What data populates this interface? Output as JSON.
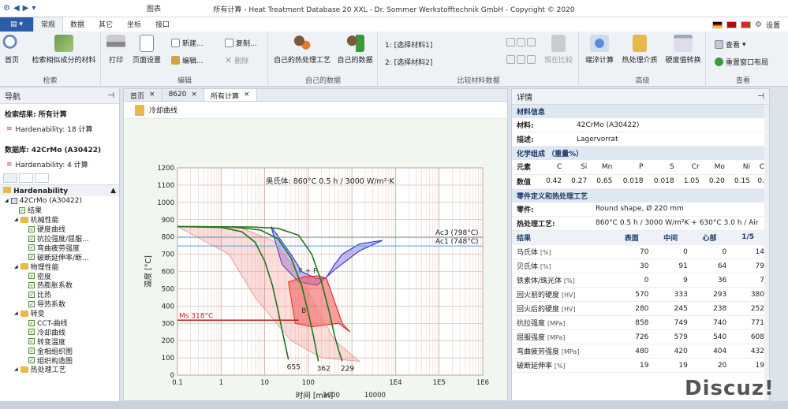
{
  "window": {
    "title": "所有计算 - Heat Treatment Database 20 XXL - Dr. Sommer Werkstofftechnik GmbH - Copyright © 2020",
    "contextual_group": "图表"
  },
  "ribbon_tabs": [
    "常规",
    "数据",
    "其它",
    "坐标",
    "接口"
  ],
  "settings_label": "设置",
  "ribbon": {
    "search": {
      "home": "首页",
      "similar": "检索相似成分的材料",
      "group": "检索"
    },
    "edit": {
      "print": "打印",
      "page_setup": "页面设置",
      "new": "新建...",
      "edit": "编辑...",
      "copy": "复制...",
      "delete": "删除",
      "group": "编辑"
    },
    "own": {
      "own_ht": "自己的热处理工艺",
      "own_data": "自己的数据",
      "group": "自己的数据"
    },
    "compare": {
      "sel1": "1: [选择材料1]",
      "sel2": "2: [选择材料2]",
      "compare_now": "现在比较",
      "group": "比较材料数据"
    },
    "advanced": {
      "quench_calc": "端淬计算",
      "ht_media": "热处理介质",
      "hardness_conv": "硬度值转换",
      "group": "高级"
    },
    "view": {
      "view": "查看",
      "reset_layout": "重置窗口布局",
      "group": "查看"
    }
  },
  "nav": {
    "title": "导航",
    "search_result_title": "检索结果: 所有计算",
    "search_result_item": "Hardenability: 18 计算",
    "db_title": "数据库: 42CrMo (A30422)",
    "db_item": "Hardenability: 4 计算",
    "tree_header": "Hardenability",
    "tree": [
      {
        "label": "42CrMo (A30422)",
        "level": 1,
        "type": "grid"
      },
      {
        "label": "结果",
        "level": 2,
        "type": "cb"
      },
      {
        "label": "机械性能",
        "level": 2,
        "type": "folder"
      },
      {
        "label": "硬度曲线",
        "level": 3,
        "type": "cb"
      },
      {
        "label": "抗拉强度/屈服...",
        "level": 3,
        "type": "cb"
      },
      {
        "label": "弯曲疲劳强度",
        "level": 3,
        "type": "cb"
      },
      {
        "label": "破断延伸率/断...",
        "level": 3,
        "type": "cb"
      },
      {
        "label": "物理性能",
        "level": 2,
        "type": "folder"
      },
      {
        "label": "密度",
        "level": 3,
        "type": "cb"
      },
      {
        "label": "热膨胀系数",
        "level": 3,
        "type": "cb"
      },
      {
        "label": "比热",
        "level": 3,
        "type": "cb"
      },
      {
        "label": "导热系数",
        "level": 3,
        "type": "cb"
      },
      {
        "label": "转变",
        "level": 2,
        "type": "folder"
      },
      {
        "label": "CCT-曲线",
        "level": 3,
        "type": "cb"
      },
      {
        "label": "冷却曲线",
        "level": 3,
        "type": "cb"
      },
      {
        "label": "转变温度",
        "level": 3,
        "type": "cb"
      },
      {
        "label": "金相组织图",
        "level": 3,
        "type": "cb"
      },
      {
        "label": "组织构造图",
        "level": 3,
        "type": "cb"
      },
      {
        "label": "热处理工艺",
        "level": 2,
        "type": "folder"
      }
    ]
  },
  "doc_tabs": [
    "首页",
    "8620",
    "所有计算"
  ],
  "doc_title": "冷却曲线",
  "chart_data": {
    "type": "line",
    "title": "奥氏体: 860°C 0.5 h / 3000 W/m²·K",
    "xlabel": "时间 [min]",
    "ylabel": "温度 [°C]",
    "x_scale": "log",
    "xlim": [
      0.1,
      1000000
    ],
    "ylim": [
      0,
      1200
    ],
    "x_ticks": [
      0.1,
      1,
      10,
      100,
      1000,
      10000,
      100000,
      1000000
    ],
    "x_tick_labels": [
      "0.1",
      "1",
      "10",
      "100",
      "1E4",
      "1E5",
      "1E6"
    ],
    "x_tick_values": [
      0.1,
      1,
      10,
      100,
      10000,
      100000,
      1000000
    ],
    "x_extra_ticks": [
      {
        "label": "1000",
        "value": 1000
      },
      {
        "label": "10000",
        "value": 10000
      }
    ],
    "y_ticks": [
      0,
      100,
      200,
      300,
      400,
      500,
      600,
      700,
      800,
      900,
      1000,
      1100,
      1200
    ],
    "lines": [
      {
        "label": "Ac3 (798°C)",
        "y": 798,
        "color": "#4aa3e8"
      },
      {
        "label": "Ac1 (748°C)",
        "y": 748,
        "color": "#4aa3e8"
      },
      {
        "label": "Ms 318°C",
        "y": 318,
        "color": "#c02020"
      }
    ],
    "region_labels": [
      {
        "label": "F + P",
        "x": 60,
        "y": 590
      },
      {
        "label": "B",
        "x": 70,
        "y": 360
      }
    ],
    "cooling_curves": [
      {
        "label": "655",
        "points": [
          [
            0.1,
            860
          ],
          [
            1,
            855
          ],
          [
            3,
            830
          ],
          [
            6,
            770
          ],
          [
            10,
            660
          ],
          [
            15,
            520
          ],
          [
            20,
            380
          ],
          [
            25,
            260
          ],
          [
            30,
            170
          ],
          [
            35,
            90
          ]
        ]
      },
      {
        "label": "362",
        "points": [
          [
            0.1,
            860
          ],
          [
            2,
            858
          ],
          [
            8,
            840
          ],
          [
            20,
            790
          ],
          [
            40,
            680
          ],
          [
            70,
            520
          ],
          [
            100,
            360
          ],
          [
            130,
            230
          ],
          [
            150,
            150
          ],
          [
            170,
            80
          ]
        ]
      },
      {
        "label": "229",
        "points": [
          [
            0.1,
            860
          ],
          [
            5,
            858
          ],
          [
            20,
            850
          ],
          [
            60,
            810
          ],
          [
            120,
            700
          ],
          [
            200,
            540
          ],
          [
            300,
            370
          ],
          [
            400,
            230
          ],
          [
            500,
            140
          ],
          [
            600,
            80
          ]
        ]
      }
    ]
  },
  "details": {
    "title": "详情",
    "material_info_title": "材料信息",
    "material_label": "材料:",
    "material_value": "42CrMo (A30422)",
    "desc_label": "描述:",
    "desc_value": "Lagervorrat",
    "composition_title": "化学组成 （重量%）",
    "comp_head_label": "元素",
    "comp_elements": [
      "C",
      "Si",
      "Mn",
      "P",
      "S",
      "Cr",
      "Mo",
      "Ni",
      "C"
    ],
    "comp_value_label": "数值",
    "comp_values": [
      "0.42",
      "0.27",
      "0.65",
      "0.018",
      "0.018",
      "1.05",
      "0.20",
      "0.15",
      "0."
    ],
    "part_title": "零件定义和热处理工艺",
    "part_label": "零件:",
    "part_value": "Round shape, Ø 220 mm",
    "ht_label": "热处理工艺:",
    "ht_value": "860°C 0.5 h / 3000 W/m²K + 630°C 3.0 h / Air",
    "results_head": [
      "结果",
      "表面",
      "中间",
      "心部",
      "1/5"
    ],
    "results": [
      {
        "name": "马氏体",
        "unit": "[%]",
        "values": [
          "70",
          "0",
          "0",
          "14"
        ]
      },
      {
        "name": "贝氏体",
        "unit": "[%]",
        "values": [
          "30",
          "91",
          "64",
          "79"
        ]
      },
      {
        "name": "铁素体/珠光体",
        "unit": "[%]",
        "values": [
          "0",
          "9",
          "36",
          "7"
        ]
      },
      {
        "name": "回火前的硬度",
        "unit": "[HV]",
        "values": [
          "570",
          "333",
          "293",
          "380"
        ]
      },
      {
        "name": "回火后的硬度",
        "unit": "[HV]",
        "values": [
          "280",
          "245",
          "238",
          "252"
        ]
      },
      {
        "name": "抗拉强度",
        "unit": "[MPa]",
        "values": [
          "858",
          "749",
          "740",
          "771"
        ]
      },
      {
        "name": "屈服强度",
        "unit": "[MPa]",
        "values": [
          "726",
          "579",
          "540",
          "608"
        ]
      },
      {
        "name": "弯曲疲劳强度",
        "unit": "[MPa]",
        "values": [
          "480",
          "420",
          "404",
          "432"
        ]
      },
      {
        "name": "破断延伸率",
        "unit": "[%]",
        "values": [
          "19",
          "19",
          "20",
          "19"
        ]
      }
    ]
  },
  "watermark": "Discuz!"
}
